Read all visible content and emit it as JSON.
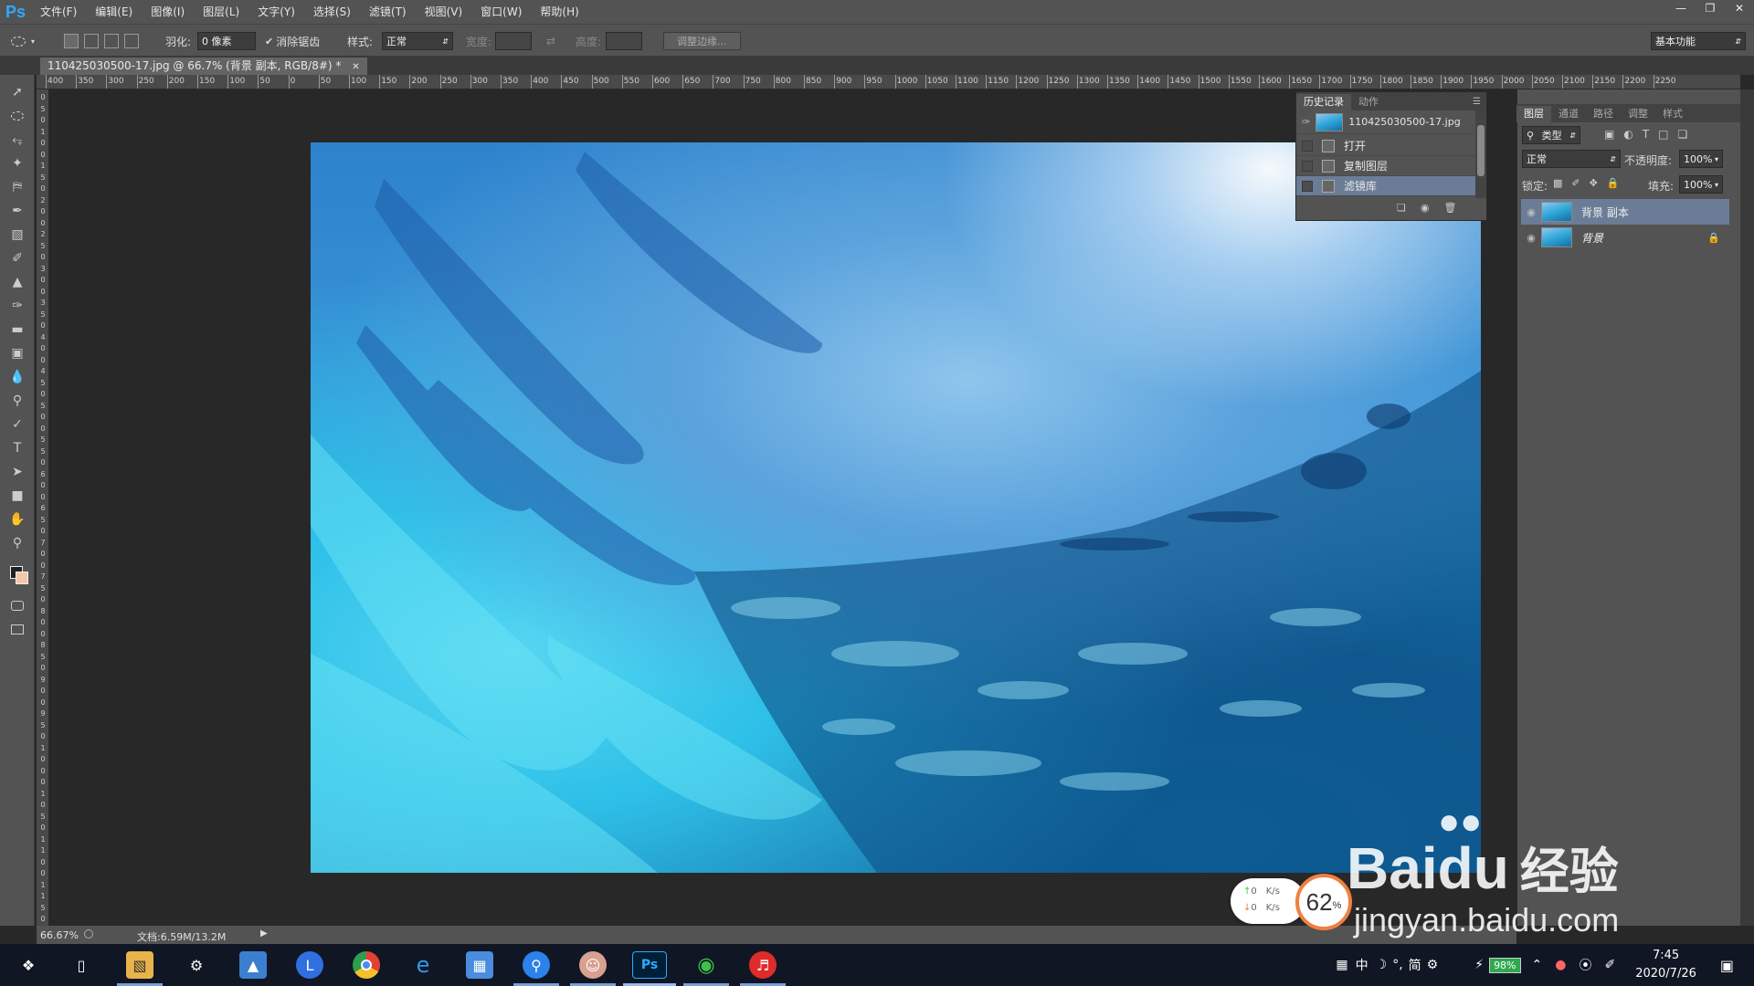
{
  "app": {
    "logo": "Ps"
  },
  "menu": [
    "文件(F)",
    "编辑(E)",
    "图像(I)",
    "图层(L)",
    "文字(Y)",
    "选择(S)",
    "滤镜(T)",
    "视图(V)",
    "窗口(W)",
    "帮助(H)"
  ],
  "options": {
    "feather_label": "羽化:",
    "feather_value": "0 像素",
    "antialias_label": "消除锯齿",
    "style_label": "样式:",
    "style_value": "正常",
    "width_label": "宽度:",
    "height_label": "高度:",
    "refine_edge": "调整边缘...",
    "workspace": "基本功能"
  },
  "document": {
    "tab_title": "110425030500-17.jpg @ 66.7% (背景 副本, RGB/8#) *",
    "zoom": "66.67%",
    "doc_size": "文档:6.59M/13.2M"
  },
  "ruler": {
    "h_ticks": [
      "400",
      "350",
      "300",
      "250",
      "200",
      "150",
      "100",
      "50",
      "0",
      "50",
      "100",
      "150",
      "200",
      "250",
      "300",
      "350",
      "400",
      "450",
      "500",
      "550",
      "600",
      "650",
      "700",
      "750",
      "800",
      "850",
      "900",
      "950",
      "1000",
      "1050",
      "1100",
      "1150",
      "1200",
      "1250",
      "1300",
      "1350",
      "1400",
      "1450",
      "1500",
      "1550",
      "1600",
      "1650",
      "1700",
      "1750",
      "1800",
      "1850",
      "1900",
      "1950",
      "2000",
      "2050",
      "2100",
      "2150",
      "2200",
      "2250"
    ],
    "v_ticks": [
      "0",
      "5",
      "0",
      "1",
      "0",
      "0",
      "1",
      "5",
      "0",
      "2",
      "0",
      "0",
      "2",
      "5",
      "0",
      "3",
      "0",
      "0",
      "3",
      "5",
      "0",
      "4",
      "0",
      "0",
      "4",
      "5",
      "0",
      "5",
      "0",
      "0",
      "5",
      "5",
      "0",
      "6",
      "0",
      "0",
      "6",
      "5",
      "0",
      "7",
      "0",
      "0",
      "7",
      "5",
      "0",
      "8",
      "0",
      "0",
      "8",
      "5",
      "0",
      "9",
      "0",
      "0",
      "9",
      "5",
      "0",
      "1",
      "0",
      "0",
      "0",
      "1",
      "0",
      "5",
      "0",
      "1",
      "1",
      "0",
      "0",
      "1",
      "1",
      "5",
      "0"
    ]
  },
  "history": {
    "tabs": [
      "历史记录",
      "动作"
    ],
    "snapshot": "110425030500-17.jpg",
    "items": [
      "打开",
      "复制图层",
      "滤镜库"
    ]
  },
  "layers": {
    "tabs": [
      "图层",
      "通道",
      "路径",
      "调整",
      "样式"
    ],
    "filter_label": "类型",
    "blend_mode": "正常",
    "opacity_label": "不透明度:",
    "opacity_value": "100%",
    "lock_label": "锁定:",
    "fill_label": "填充:",
    "fill_value": "100%",
    "items": [
      {
        "name": "背景 副本"
      },
      {
        "name": "背景"
      }
    ]
  },
  "net": {
    "up": "0",
    "down": "0",
    "unit": "K/s",
    "cpu": "62",
    "cpu_unit": "%"
  },
  "watermark": {
    "brand_a": "Bai",
    "brand_b": "du",
    "brand_cn": "经验",
    "url": "jingyan.baidu.com"
  },
  "taskbar": {
    "ime": "中",
    "ime2": "简",
    "battery": "98%",
    "time": "7:45",
    "date": "2020/7/26",
    "apps": [
      "start-icon",
      "task-view-icon",
      "file-explorer-icon",
      "settings-icon",
      "photos-icon",
      "l-app-icon",
      "chrome-icon",
      "ie-icon",
      "store-icon",
      "search-app-icon",
      "avatar-app-icon",
      "photoshop-icon",
      "wechat-icon",
      "netease-music-icon"
    ]
  },
  "colors": {
    "accent": "#31a8ff",
    "panel": "#535353",
    "selected": "#6b7d96"
  }
}
